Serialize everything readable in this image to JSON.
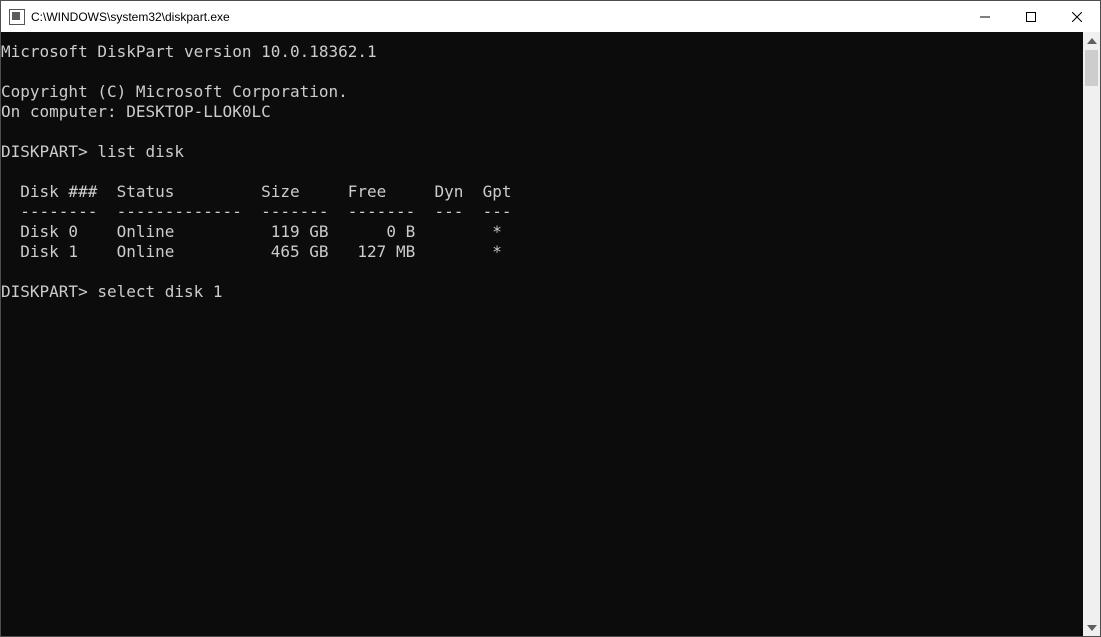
{
  "window": {
    "title": "C:\\WINDOWS\\system32\\diskpart.exe"
  },
  "console": {
    "line_version": "Microsoft DiskPart version 10.0.18362.1",
    "line_blank1": "",
    "line_copyright": "Copyright (C) Microsoft Corporation.",
    "line_computer": "On computer: DESKTOP-LLOK0LC",
    "line_blank2": "",
    "prompt1": "DISKPART> ",
    "cmd1": "list disk",
    "line_blank3": "",
    "header": "  Disk ###  Status         Size     Free     Dyn  Gpt",
    "divider": "  --------  -------------  -------  -------  ---  ---",
    "row0": "  Disk 0    Online          119 GB      0 B        *",
    "row1": "  Disk 1    Online          465 GB   127 MB        *",
    "line_blank4": "",
    "prompt2": "DISKPART> ",
    "cmd2": "select disk 1"
  },
  "disks": [
    {
      "id": "Disk 0",
      "status": "Online",
      "size": "119 GB",
      "free": "0 B",
      "dyn": "",
      "gpt": "*"
    },
    {
      "id": "Disk 1",
      "status": "Online",
      "size": "465 GB",
      "free": "127 MB",
      "dyn": "",
      "gpt": "*"
    }
  ]
}
